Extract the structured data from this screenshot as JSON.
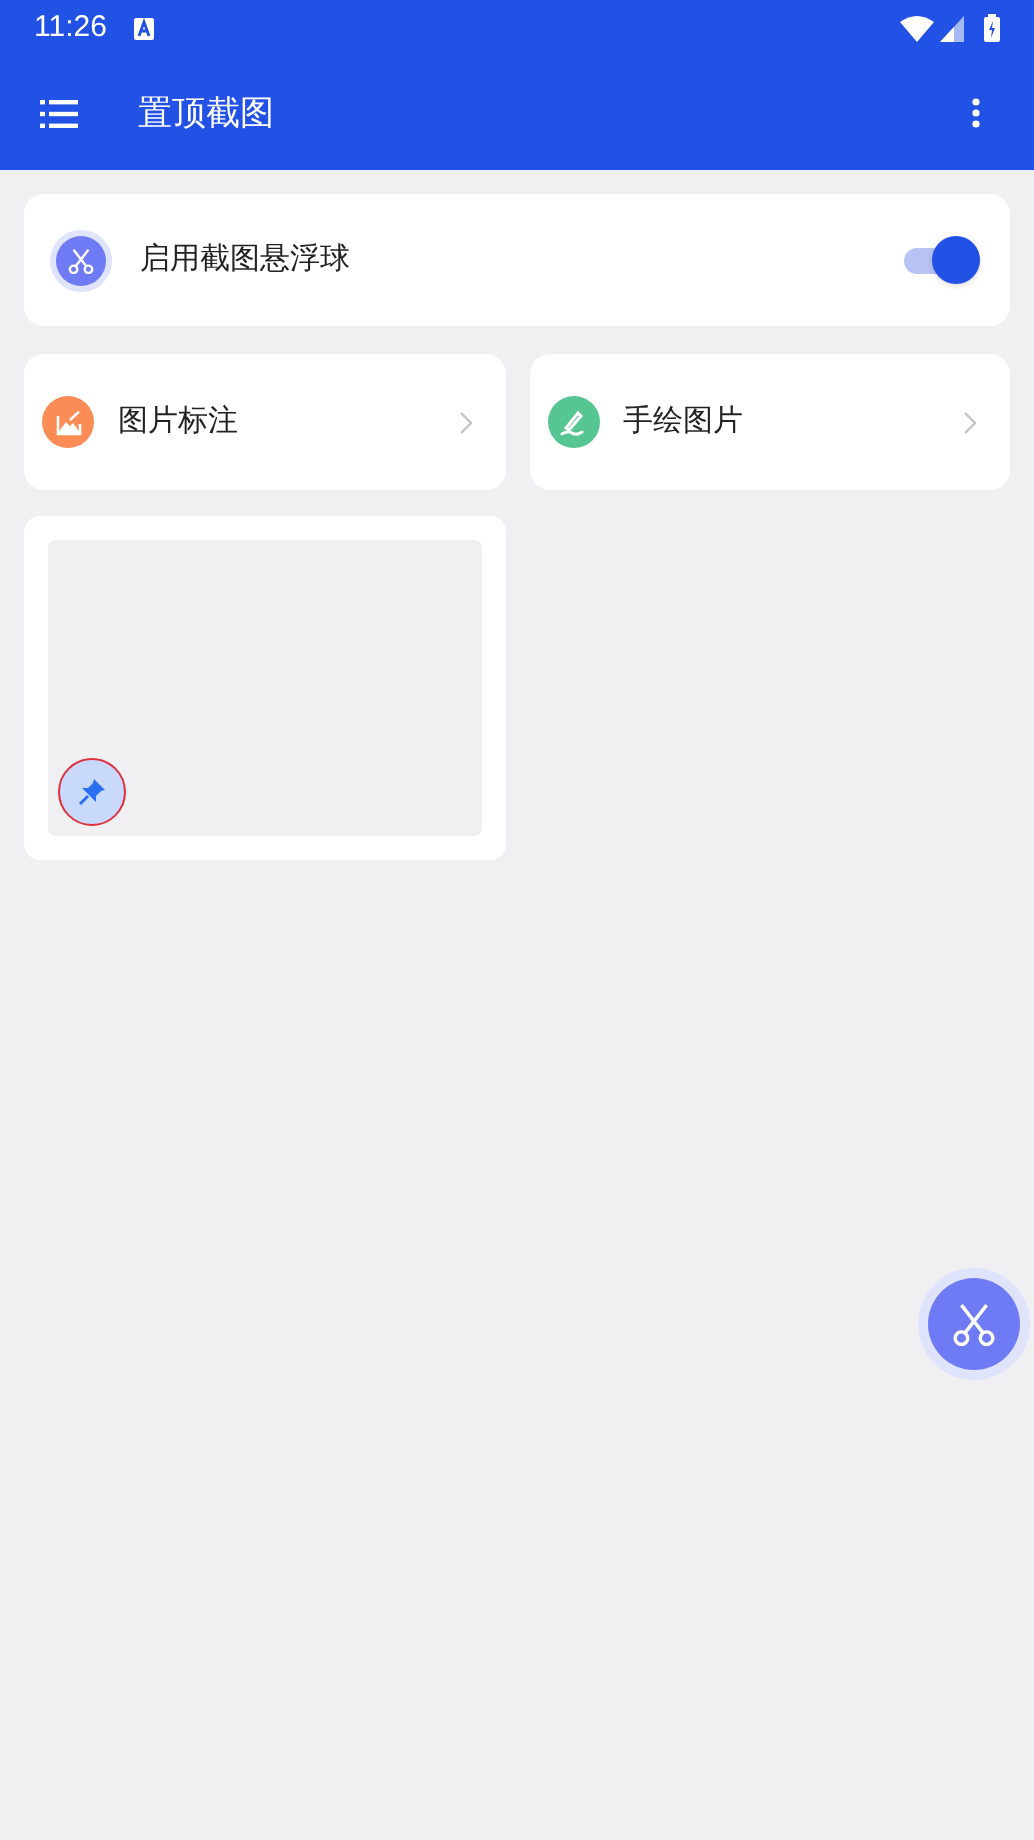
{
  "status_bar": {
    "time": "11:26"
  },
  "app_bar": {
    "title": "置顶截图"
  },
  "float_ball_setting": {
    "label": "启用截图悬浮球",
    "on": true
  },
  "tools": [
    {
      "label": "图片标注",
      "kind": "annotate"
    },
    {
      "label": "手绘图片",
      "kind": "draw"
    }
  ],
  "screenshots": [
    {
      "pinned": true
    }
  ]
}
